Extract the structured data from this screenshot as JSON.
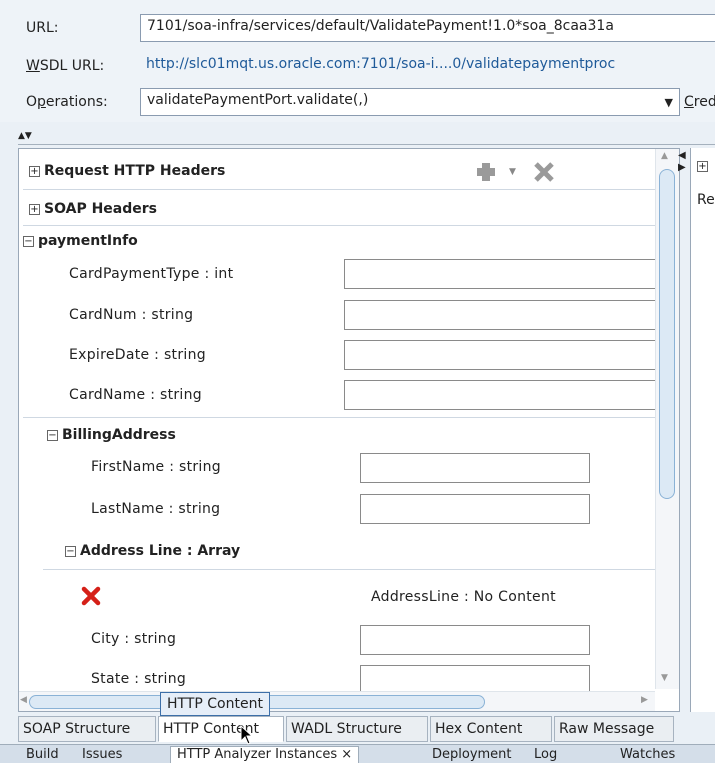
{
  "form": {
    "url_label": "URL:",
    "url_value": "7101/soa-infra/services/default/ValidatePayment!1.0*soa_8caa31a",
    "wsdl_label_rest": "SDL URL:",
    "wsdl_label_mnemonic": "W",
    "wsdl_value": "http://slc01mqt.us.oracle.com:7101/soa-i....0/validatepaymentproc",
    "operations_label_pre": "O",
    "operations_label_mnemonic": "p",
    "operations_label_rest": "erations:",
    "operations_value": "validatePaymentPort.validate(,)",
    "credentials_mnemonic": "C",
    "credentials_rest": "redent"
  },
  "request": {
    "http_headers": "Request HTTP Headers",
    "soap_headers": "SOAP Headers",
    "payment_info": "paymentInfo",
    "fields": {
      "card_payment_type": "CardPaymentType : int",
      "card_num": "CardNum : string",
      "expire_date": "ExpireDate : string",
      "card_name": "CardName : string"
    },
    "billing_address": "BillingAddress",
    "billing_fields": {
      "first_name": "FirstName : string",
      "last_name": "LastName : string"
    },
    "address_line": "Address Line : Array",
    "address_line_empty": "AddressLine : No Content",
    "city": "City : string",
    "state": "State : string"
  },
  "tooltip": "HTTP Content",
  "side": {
    "text": "Re"
  },
  "tabs": [
    "SOAP Structure",
    "HTTP Content",
    "WADL Structure",
    "Hex Content",
    "Raw Message"
  ],
  "bottom_tabs": [
    "Build",
    "Issues",
    "HTTP Analyzer Instances",
    "Deployment",
    "Log",
    "Watches"
  ]
}
